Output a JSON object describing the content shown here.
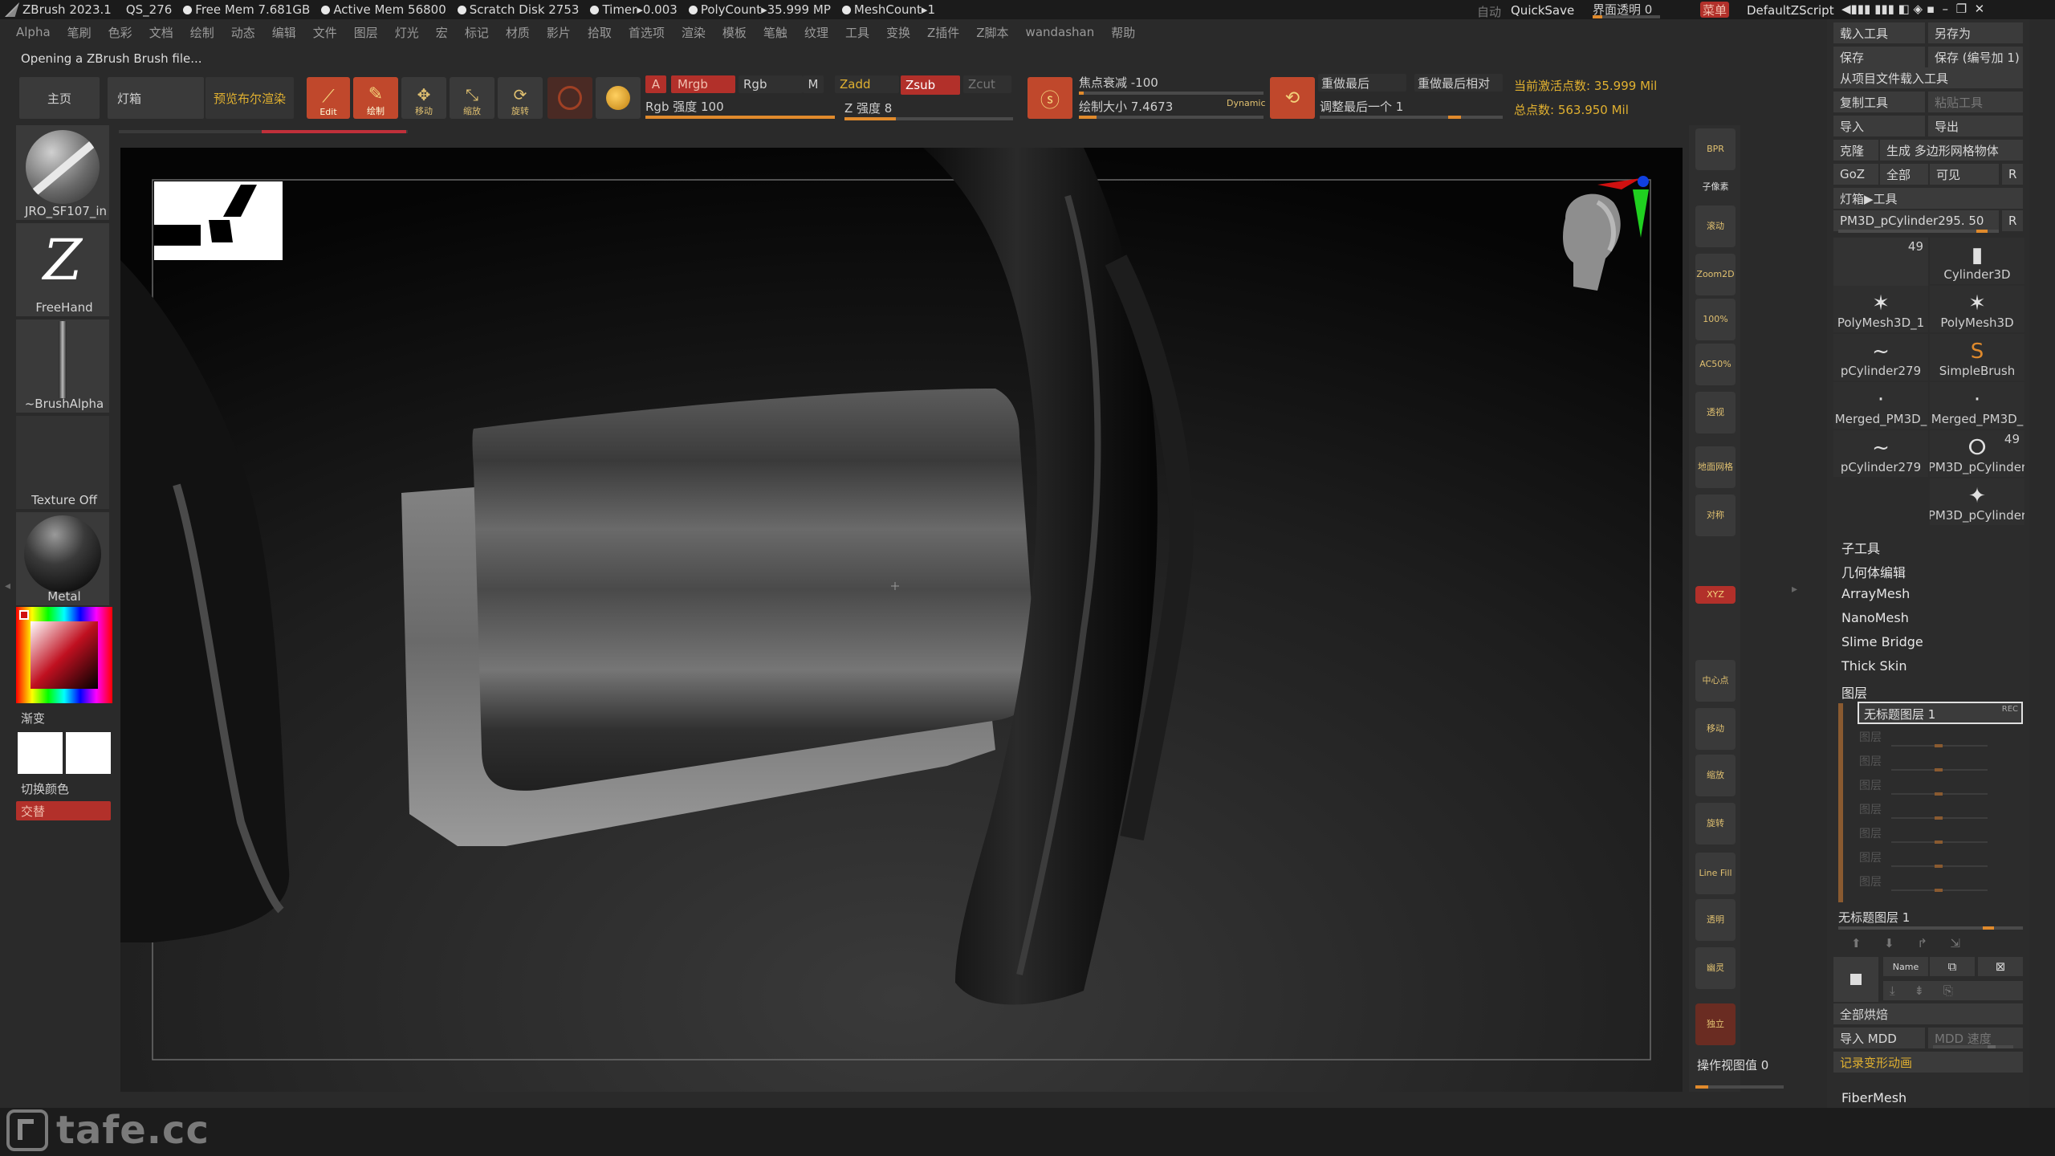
{
  "titlebar": {
    "app": "ZBrush 2023.1",
    "doc": "QS_276",
    "stats": [
      "Free Mem 7.681GB",
      "Active Mem 56800",
      "Scratch Disk 2753",
      "Timer▸0.003",
      "PolyCount▸35.999 MP",
      "MeshCount▸1"
    ],
    "auto": "自动",
    "quicksave": "QuickSave",
    "ui_transparency": "界面透明 0",
    "menu_btn": "菜单",
    "script": "DefaultZScript"
  },
  "menubar": [
    "Alpha",
    "笔刷",
    "色彩",
    "文档",
    "绘制",
    "动态",
    "编辑",
    "文件",
    "图层",
    "灯光",
    "宏",
    "标记",
    "材质",
    "影片",
    "拾取",
    "首选项",
    "渲染",
    "模板",
    "笔触",
    "纹理",
    "工具",
    "变换",
    "Z插件",
    "Z脚本",
    "wandashan",
    "帮助"
  ],
  "status_message": "Opening a ZBrush Brush file...",
  "toolbar": {
    "home": "主页",
    "lightbox": "灯箱",
    "bpr": "预览布尔渲染",
    "edit": "Edit",
    "draw": "绘制",
    "move": "移动",
    "scale": "缩放",
    "rotate": "旋转",
    "a": "A",
    "mrgb": "Mrgb",
    "rgb": "Rgb",
    "m": "M",
    "zadd": "Zadd",
    "zsub": "Zsub",
    "zcut": "Zcut",
    "rgb_intensity": "Rgb 强度 100",
    "z_intensity": "Z 强度 8",
    "focal_shift": "焦点衰减 -100",
    "draw_size": "绘制大小 7.4673",
    "dynamic": "Dynamic",
    "redo_last": "重做最后",
    "redo_last_rel": "重做最后相对",
    "adjust_last": "调整最后一个 1",
    "active_points": "当前激活点数: 35.999 Mil",
    "total_points": "总点数: 563.950 Mil"
  },
  "left_panel": {
    "brush": "JRO_SF107_in",
    "stroke": "FreeHand",
    "alpha": "~BrushAlpha",
    "texture": "Texture Off",
    "material": "Metal",
    "gradient": "渐变",
    "switch_color": "切换颜色",
    "alternate": "交替"
  },
  "right_toolbar": [
    "BPR",
    "子像素",
    "滚动",
    "Zoom2D",
    "100%",
    "AC50%",
    "透视",
    "地面网格",
    "对称",
    "XYZ",
    "中心点",
    "移动",
    "缩放",
    "旋转",
    "Line Fill",
    "透明",
    "幽灵",
    "独立"
  ],
  "right_bottom": {
    "viewport_value": "操作视图值 0"
  },
  "right_panel": {
    "load_tool": "载入工具",
    "save_as": "另存为",
    "save": "保存",
    "save_inc": "保存 (编号加 1)",
    "load_from_project": "从项目文件载入工具",
    "copy_tool": "复制工具",
    "paste_tool": "粘贴工具",
    "import": "导入",
    "export": "导出",
    "clone": "克隆",
    "make_polymesh": "生成 多边形网格物体",
    "goz": "GoZ",
    "all": "全部",
    "visible": "可见",
    "r": "R",
    "lightbox_tool": "灯箱▶工具",
    "current_tool": "PM3D_pCylinder295. 50",
    "tools": [
      {
        "label": "PM3D_pCylinder",
        "count": "49"
      },
      {
        "label": "Cylinder3D",
        "count": ""
      },
      {
        "label": "PolyMesh3D",
        "count": ""
      },
      {
        "label": "PolyMesh3D_1",
        "count": ""
      },
      {
        "label": "SimpleBrush",
        "count": ""
      },
      {
        "label": "pCylinder279",
        "count": ""
      },
      {
        "label": "Merged_PM3D_",
        "count": ""
      },
      {
        "label": "Merged_PM3D_",
        "count": ""
      },
      {
        "label": "PM3D_pCylinder",
        "count": "49"
      },
      {
        "label": "pCylinder279",
        "count": ""
      },
      {
        "label": "PM3D_pCylinder",
        "count": ""
      }
    ],
    "subtool": "子工具",
    "geometry": "几何体编辑",
    "arraymesh": "ArrayMesh",
    "nanomesh": "NanoMesh",
    "slimebridge": "Slime Bridge",
    "thickskin": "Thick Skin",
    "layers": "图层",
    "layer_active": "无标题图层 1",
    "layer_rec": "REC",
    "layer_placeholders": [
      "图层",
      "图层",
      "图层",
      "图层",
      "图层",
      "图层",
      "图层"
    ],
    "layer_current": "无标题图层 1",
    "name_btn": "Name",
    "bake_all": "全部烘焙",
    "import_mdd": "导入 MDD",
    "mdd_speed": "MDD 速度",
    "record_anim": "记录变形动画",
    "fibermesh": "FiberMesh"
  },
  "watermark": "tafe.cc",
  "colors": {
    "accent": "#e08a2c",
    "red": "#c0482c",
    "yellow": "#e0b030"
  }
}
